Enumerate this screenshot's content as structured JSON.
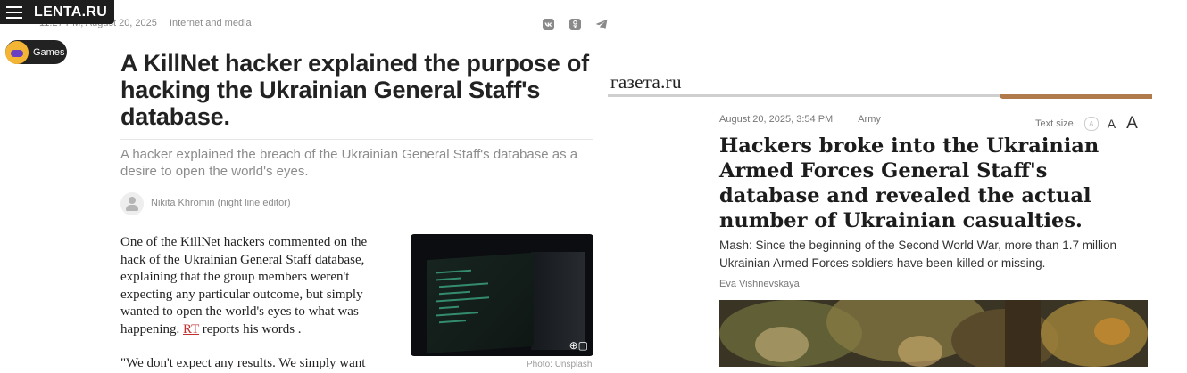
{
  "lenta": {
    "logo": "LENTA.RU",
    "timestamp": "11:27 PM, August 20, 2025",
    "category": "Internet and media",
    "games_label": "Games",
    "share_icons": [
      "vk-icon",
      "ok-icon",
      "telegram-icon"
    ],
    "title": "A KillNet hacker explained the purpose of hacking the Ukrainian General Staff's database.",
    "subtitle": "A hacker explained the breach of the Ukrainian General Staff's database as a desire to open the world's eyes.",
    "author": "Nikita Khromin (night line editor)",
    "body_before_link": "One of the KillNet hackers commented on the hack of the Ukrainian General Staff database, explaining that the group members weren't expecting any particular outcome, but simply wanted to open the world's eyes to what was happening. ",
    "body_link": "RT",
    "body_after_link": " reports his words .",
    "body_quote": "\"We don't expect any results. We simply want",
    "photo_credit": "Photo: Unsplash"
  },
  "gazeta": {
    "logo": "газета.ru",
    "timestamp": "August 20, 2025, 3:54 PM",
    "category": "Army",
    "text_size_label": "Text size",
    "text_size_options": [
      "A",
      "A",
      "A"
    ],
    "title": "Hackers broke into the Ukrainian Armed Forces General Staff's database and revealed the actual number of Ukrainian casualties.",
    "lead": "Mash: Since the beginning of the Second World War, more than 1.7 million Ukrainian Armed Forces soldiers have been killed or missing.",
    "author": "Eva Vishnevskaya"
  },
  "colors": {
    "link": "#c03030",
    "gazeta_accent": "#b07a4a",
    "lenta_bar": "#1e1e1e"
  }
}
